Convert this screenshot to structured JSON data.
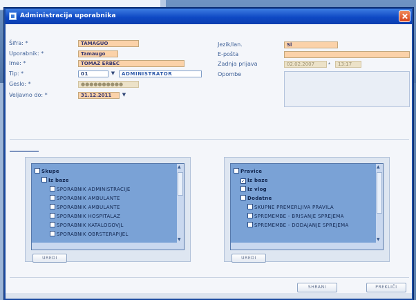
{
  "dialog": {
    "title": "Administracija uporabnika",
    "labels": {
      "sifra": "Šifra: *",
      "uporabnik": "Uporabnik: *",
      "ime": "Ime: *",
      "tip": "Tip: *",
      "geslo": "Geslo: *",
      "veljavno": "Veljavno do: *",
      "jezik": "Jezik/lan.",
      "email": "E-pošta",
      "zadnja": "Zadnja prijava",
      "opombe": "Opombe"
    },
    "values": {
      "sifra": "TAMAGUO",
      "uporabnik": "Tamaugo",
      "ime": "TOMAŽ ERBEC",
      "tip_code": "01",
      "tip_name": "ADMINISTRATOR",
      "geslo": "●●●●●●●●●●",
      "veljavno": "31.12.2011",
      "jezik": "Sl",
      "email": "",
      "zadnja_date": "02.02.2007",
      "zadnja_time": "13:17",
      "opombe": ""
    }
  },
  "left_tree": {
    "nodes": [
      {
        "label": "Skupe",
        "level": 0,
        "checked": false
      },
      {
        "label": "Iz baze",
        "level": 1,
        "checked": false
      },
      {
        "label": "SPORABNIK ADMINISTRACIJE",
        "level": 2,
        "checked": false
      },
      {
        "label": "SPORABNIK AMBULANTE",
        "level": 2,
        "checked": false
      },
      {
        "label": "SPORABNIK AMBULANTE",
        "level": 2,
        "checked": false
      },
      {
        "label": "SPORABNIK HOSPITALAZ",
        "level": 2,
        "checked": false
      },
      {
        "label": "SPORABNIK KATALOGOVJL",
        "level": 2,
        "checked": false
      },
      {
        "label": "SPORABNIK OBRSTERAPIJEL",
        "level": 2,
        "checked": false
      }
    ],
    "button_label": "UREDI"
  },
  "right_tree": {
    "nodes": [
      {
        "label": "Pravice",
        "level": 0,
        "checked": false
      },
      {
        "label": "Iz baze",
        "level": 1,
        "checked": true
      },
      {
        "label": "Iz vlog",
        "level": 1,
        "checked": false
      },
      {
        "label": "Dodatne",
        "level": 1,
        "checked": false
      },
      {
        "label": "SKUPNE PREMERLJIVA PRAVILA",
        "level": 2,
        "checked": false
      },
      {
        "label": "SPREMEMBE - BRISANJE SPREJEMA",
        "level": 2,
        "checked": false
      },
      {
        "label": "SPREMEMBE - DODAJANJE SPREJEMA",
        "level": 2,
        "checked": false
      }
    ],
    "button_label": "UREDI"
  },
  "footer": {
    "ok_label": "SHRANI",
    "cancel_label": "PREKLIČI"
  },
  "colors": {
    "titlebar": "#0f49c4",
    "tree_bg": "#7aa2d6",
    "field_orange": "#fbd2a9"
  }
}
